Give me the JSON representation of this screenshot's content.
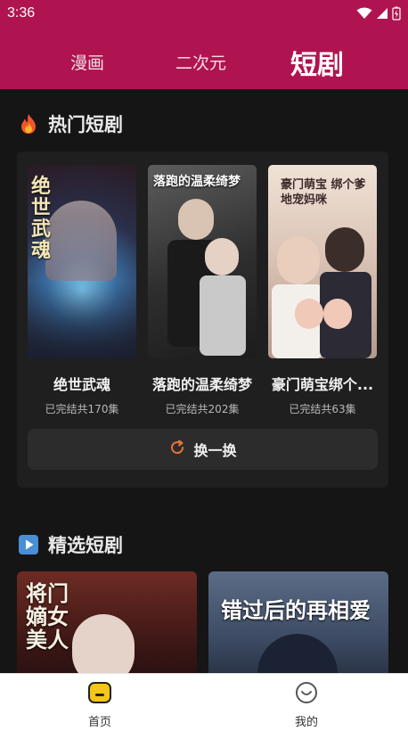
{
  "status_bar": {
    "time": "3:36"
  },
  "top_tabs": [
    {
      "label": "漫画"
    },
    {
      "label": "二次元"
    },
    {
      "label": "短剧",
      "active": true
    }
  ],
  "hot_section": {
    "title": "热门短剧",
    "icon": "fire-icon",
    "items": [
      {
        "name": "绝世武魂",
        "count": "已完结共170集",
        "poster_text": "绝世武魂"
      },
      {
        "name": "落跑的温柔绮梦",
        "count": "已完结共202集",
        "poster_text": "落跑的温柔绮梦"
      },
      {
        "name": "豪门萌宝绑个...",
        "count": "已完结共63集",
        "poster_text": "豪门萌宝 绑个爹地宠妈咪"
      }
    ],
    "shuffle_label": "换一换"
  },
  "featured_section": {
    "title": "精选短剧",
    "icon": "play-icon",
    "items": [
      {
        "poster_text": "将门嫡女美人"
      },
      {
        "poster_text": "错过后的再相爱"
      }
    ]
  },
  "bottom_nav": {
    "items": [
      {
        "label": "首页",
        "icon": "home-tv-icon",
        "active": true
      },
      {
        "label": "我的",
        "icon": "smile-icon"
      }
    ]
  },
  "colors": {
    "accent": "#b01450",
    "background": "#151515",
    "card": "#1f1f1f",
    "shuffle_icon": "#e8743b",
    "nav_home_icon": "#f5c518"
  }
}
